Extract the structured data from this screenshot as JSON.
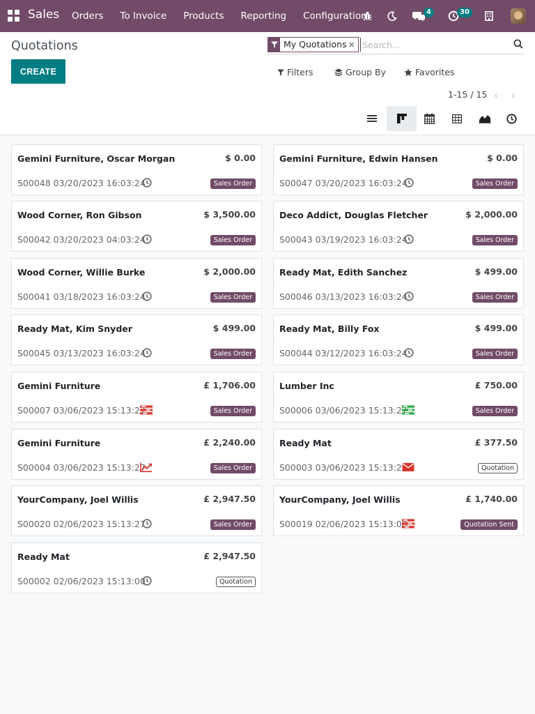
{
  "navbar": {
    "app_name": "Sales",
    "menu": [
      "Orders",
      "To Invoice",
      "Products",
      "Reporting",
      "Configuration"
    ],
    "messages_count": "4",
    "activities_count": "30",
    "color": "#714b67"
  },
  "control_panel": {
    "title": "Quotations",
    "create_label": "CREATE",
    "facet_label": "My Quotations",
    "facet_remove": "×",
    "search_placeholder": "Search...",
    "filters_label": "Filters",
    "groupby_label": "Group By",
    "favorites_label": "Favorites",
    "pager": "1-15 / 15",
    "pager_prev": "‹",
    "pager_next": "›",
    "views": [
      "list",
      "kanban",
      "calendar",
      "pivot",
      "graph",
      "activity"
    ],
    "active_view": "kanban"
  },
  "cards": [
    {
      "name": "Gemini Furniture, Oscar Morgan",
      "amount": "$ 0.00",
      "ref": "S00048 03/20/2023 16:03:24",
      "activity": "clock-icon",
      "status": "Sales Order",
      "status_style": "filled"
    },
    {
      "name": "Gemini Furniture, Edwin Hansen",
      "amount": "$ 0.00",
      "ref": "S00047 03/20/2023 16:03:24",
      "activity": "clock-icon",
      "status": "Sales Order",
      "status_style": "filled"
    },
    {
      "name": "Wood Corner, Ron Gibson",
      "amount": "$ 3,500.00",
      "ref": "S00042 03/20/2023 04:03:24",
      "activity": "clock-icon",
      "status": "Sales Order",
      "status_style": "filled"
    },
    {
      "name": "Deco Addict, Douglas Fletcher",
      "amount": "$ 2,000.00",
      "ref": "S00043 03/19/2023 16:03:24",
      "activity": "clock-icon",
      "status": "Sales Order",
      "status_style": "filled"
    },
    {
      "name": "Wood Corner, Willie Burke",
      "amount": "$ 2,000.00",
      "ref": "S00041 03/18/2023 16:03:24",
      "activity": "clock-icon",
      "status": "Sales Order",
      "status_style": "filled"
    },
    {
      "name": "Ready Mat, Edith Sanchez",
      "amount": "$ 499.00",
      "ref": "S00046 03/13/2023 16:03:24",
      "activity": "clock-icon",
      "status": "Sales Order",
      "status_style": "filled"
    },
    {
      "name": "Ready Mat, Kim Snyder",
      "amount": "$ 499.00",
      "ref": "S00045 03/13/2023 16:03:24",
      "activity": "clock-icon",
      "status": "Sales Order",
      "status_style": "filled"
    },
    {
      "name": "Ready Mat, Billy Fox",
      "amount": "$ 499.00",
      "ref": "S00044 03/12/2023 16:03:24",
      "activity": "clock-icon",
      "status": "Sales Order",
      "status_style": "filled"
    },
    {
      "name": "Gemini Furniture",
      "amount": "£ 1,706.00",
      "ref": "S00007 03/06/2023 15:13:27",
      "activity": "tasks-icon-red",
      "status": "Sales Order",
      "status_style": "filled"
    },
    {
      "name": "Lumber Inc",
      "amount": "£ 750.00",
      "ref": "S00006 03/06/2023 15:13:27",
      "activity": "tasks-icon-green",
      "status": "Sales Order",
      "status_style": "filled"
    },
    {
      "name": "Gemini Furniture",
      "amount": "£ 2,240.00",
      "ref": "S00004 03/06/2023 15:13:27",
      "activity": "chart-line-icon-red",
      "status": "Sales Order",
      "status_style": "filled"
    },
    {
      "name": "Ready Mat",
      "amount": "£ 377.50",
      "ref": "S00003 03/06/2023 15:13:25",
      "activity": "envelope-icon-red",
      "status": "Quotation",
      "status_style": "outline"
    },
    {
      "name": "YourCompany, Joel Willis",
      "amount": "£ 2,947.50",
      "ref": "S00020 02/06/2023 15:13:27",
      "activity": "clock-icon",
      "status": "Sales Order",
      "status_style": "filled"
    },
    {
      "name": "YourCompany, Joel Willis",
      "amount": "£ 1,740.00",
      "ref": "S00019 02/06/2023 15:13:00",
      "activity": "tasks-icon-red",
      "status": "Quotation Sent",
      "status_style": "filled"
    },
    {
      "name": "Ready Mat",
      "amount": "£ 2,947.50",
      "ref": "S00002 02/06/2023 15:13:00",
      "activity": "clock-icon",
      "status": "Quotation",
      "status_style": "outline"
    }
  ]
}
